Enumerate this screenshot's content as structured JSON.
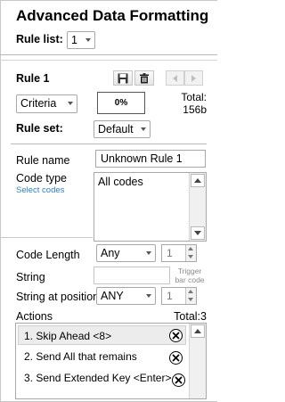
{
  "header": {
    "title": "Advanced Data Formatting",
    "rule_list_label": "Rule list:",
    "rule_list_value": "1"
  },
  "rule": {
    "heading": "Rule 1",
    "criteria_label": "Criteria",
    "percent_value": "0%",
    "total_label": "Total:",
    "total_value": "156b",
    "rule_set_label": "Rule set:",
    "rule_set_value": "Default"
  },
  "fields": {
    "rule_name_label": "Rule name",
    "rule_name_value": "Unknown Rule 1",
    "code_type_label": "Code type",
    "select_codes_link": "Select codes",
    "code_type_value": "All codes",
    "code_length_label": "Code Length",
    "code_length_value": "Any",
    "code_length_count": "1",
    "string_label": "String",
    "string_value": "",
    "trigger_label_1": "Trigger",
    "trigger_label_2": "bar code",
    "string_position_label": "String at position",
    "string_position_value": "ANY",
    "string_position_count": "1"
  },
  "actions": {
    "label": "Actions",
    "total": "Total:3",
    "items": [
      "1. Skip Ahead <8>",
      "2. Send All that remains",
      "3. Send Extended Key <Enter>"
    ]
  },
  "colors": {
    "link": "#2b7fc4",
    "selected_row": "#ececec",
    "border": "#a8a8a8"
  }
}
